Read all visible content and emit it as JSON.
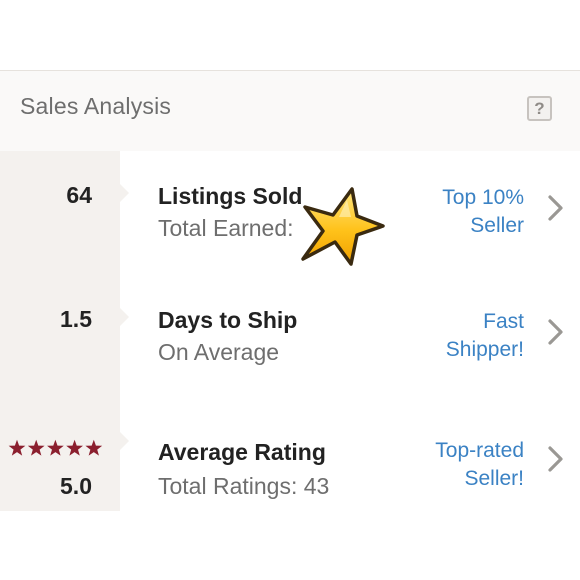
{
  "panel": {
    "title": "Sales Analysis",
    "help_label": "?"
  },
  "rows": [
    {
      "stat": "64",
      "title": "Listings Sold",
      "subtitle": "Total Earned:",
      "badge_line1": "Top 10%",
      "badge_line2": "Seller"
    },
    {
      "stat": "1.5",
      "title": "Days to Ship",
      "subtitle": "On Average",
      "badge_line1": "Fast",
      "badge_line2": "Shipper!"
    },
    {
      "stat": "5.0",
      "rating_stars": 5,
      "title": "Average Rating",
      "subtitle": "Total Ratings: 43",
      "badge_line1": "Top-rated",
      "badge_line2": "Seller!"
    }
  ],
  "colors": {
    "link": "#3b82c4",
    "star_rating": "#8b1f2e",
    "sticker_star": "#f7b500"
  },
  "icons": {
    "help": "question-mark-icon",
    "chevron": "chevron-right-icon",
    "rating": "star-icon",
    "sticker": "star-icon"
  }
}
